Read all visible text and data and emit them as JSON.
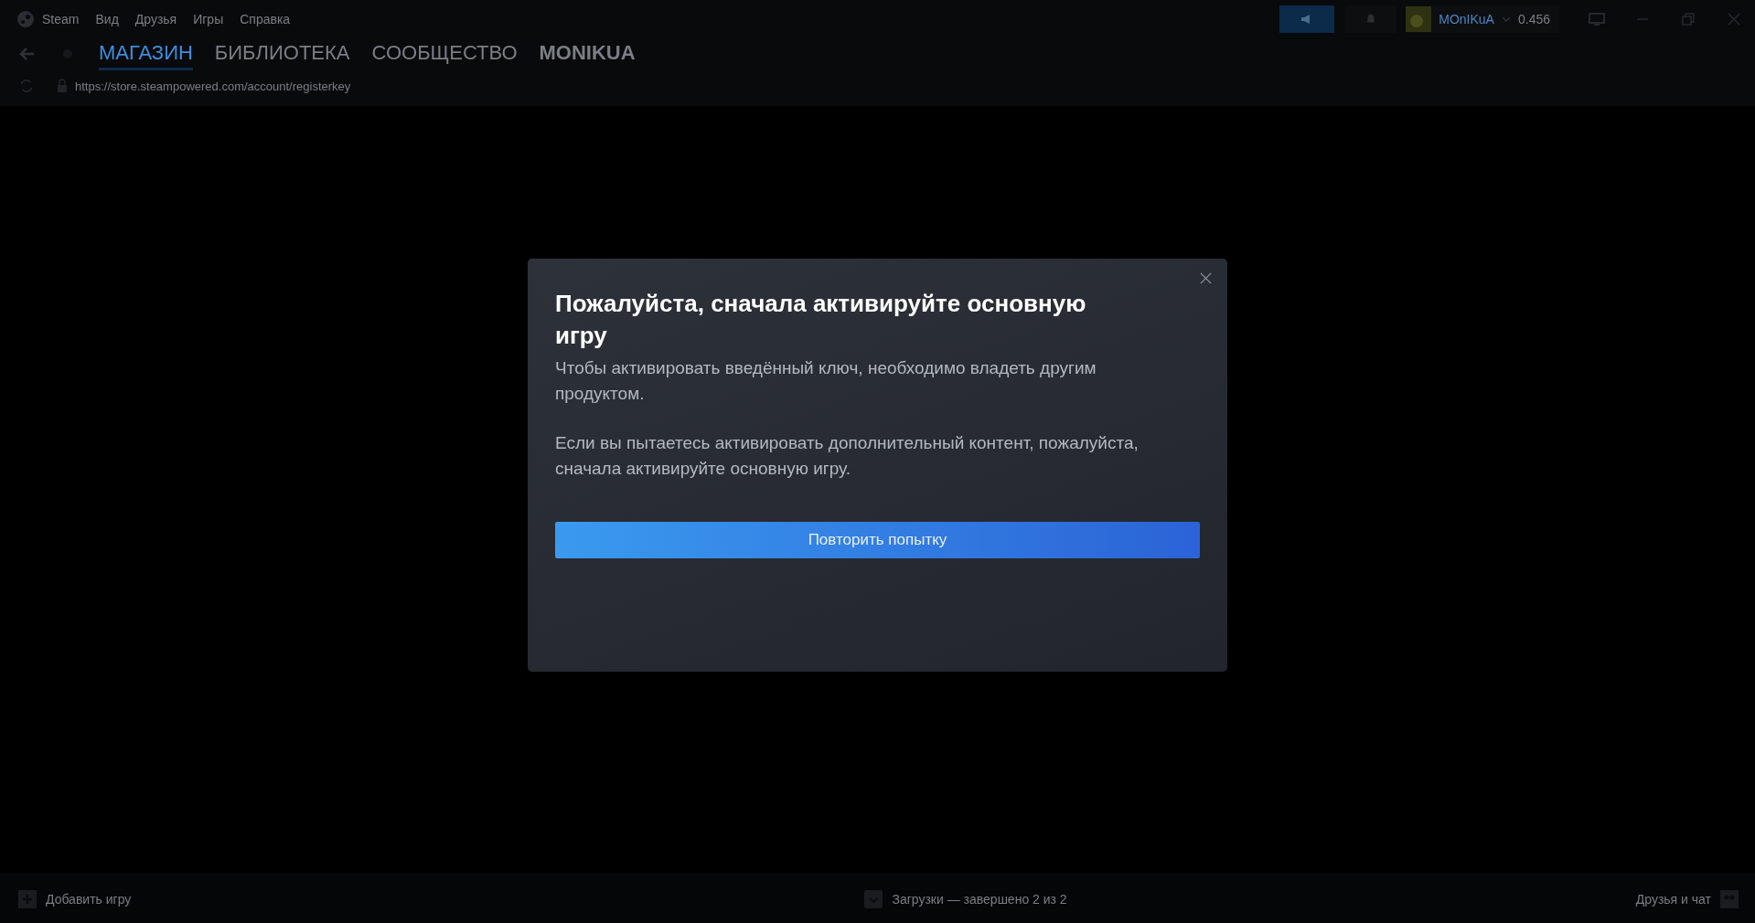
{
  "menu": [
    "Steam",
    "Вид",
    "Друзья",
    "Игры",
    "Справка"
  ],
  "account": {
    "name": "MOnIKuA",
    "balance": "0.456"
  },
  "tabs": [
    {
      "label": "МАГАЗИН",
      "selected": true,
      "kind": "normal"
    },
    {
      "label": "БИБЛИОТЕКА",
      "selected": false,
      "kind": "normal"
    },
    {
      "label": "СООБЩЕСТВО",
      "selected": false,
      "kind": "normal"
    },
    {
      "label": "MONIKUA",
      "selected": false,
      "kind": "profile"
    }
  ],
  "url": "https://store.steampowered.com/account/registerkey",
  "dialog": {
    "title": "Пожалуйста, сначала активируйте основную игру",
    "paragraphs": [
      "Чтобы активировать введённый ключ, необходимо владеть другим продуктом.",
      "Если вы пытаетесь активировать дополнительный контент, пожалуйста, сначала активируйте основную игру."
    ],
    "button": "Повторить попытку"
  },
  "status_bar": {
    "add_game": "Добавить игру",
    "downloads": "Загрузки — завершено 2 из 2",
    "friends": "Друзья и чат"
  }
}
